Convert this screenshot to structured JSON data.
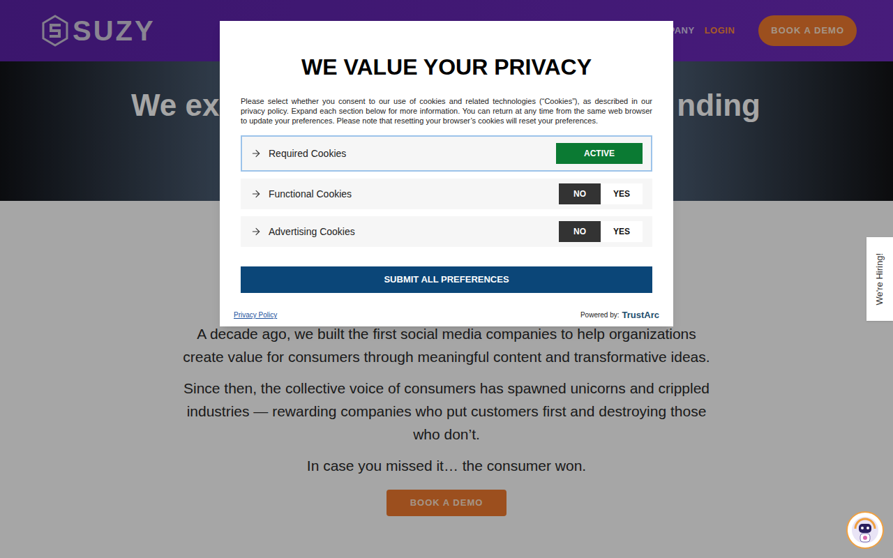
{
  "header": {
    "logo": "SUZY",
    "nav": [
      {
        "label": "OMPANY",
        "kind": "link"
      },
      {
        "label": "LOGIN",
        "kind": "accent"
      }
    ],
    "cta": "BOOK A DEMO"
  },
  "hero": {
    "heading_left": "We ex",
    "heading_right": "nding"
  },
  "content": {
    "paragraphs": [
      "A decade ago, we built the first social media companies to help organizations create value for consumers through meaningful content and transformative ideas.",
      "Since then, the collective voice of consumers has spawned unicorns and crippled industries — rewarding companies who put customers first and destroying those who don’t.",
      "In case you missed it… the consumer won."
    ],
    "cta": "BOOK A DEMO"
  },
  "side_tab": "We're Hiring!",
  "dialog": {
    "title": "WE VALUE YOUR PRIVACY",
    "description": "Please select whether you consent to our use of cookies and related technologies (“Cookies”), as described in our privacy policy. Expand each section below for more information. You can return at any time from the same web browser to update your preferences. Please note that resetting your browser’s cookies will reset your preferences.",
    "categories": [
      {
        "label": "Required Cookies",
        "kind": "fixed",
        "status": "ACTIVE",
        "focused": true
      },
      {
        "label": "Functional Cookies",
        "kind": "toggle",
        "focused": false,
        "options": [
          {
            "label": "NO",
            "selected": true
          },
          {
            "label": "YES",
            "selected": false
          }
        ]
      },
      {
        "label": "Advertising Cookies",
        "kind": "toggle",
        "focused": false,
        "options": [
          {
            "label": "NO",
            "selected": true
          },
          {
            "label": "YES",
            "selected": false
          }
        ]
      }
    ],
    "submit": "SUBMIT ALL PREFERENCES",
    "privacy_link": "Privacy Policy",
    "powered_by": "Powered by:",
    "brand": "TrustArc"
  }
}
